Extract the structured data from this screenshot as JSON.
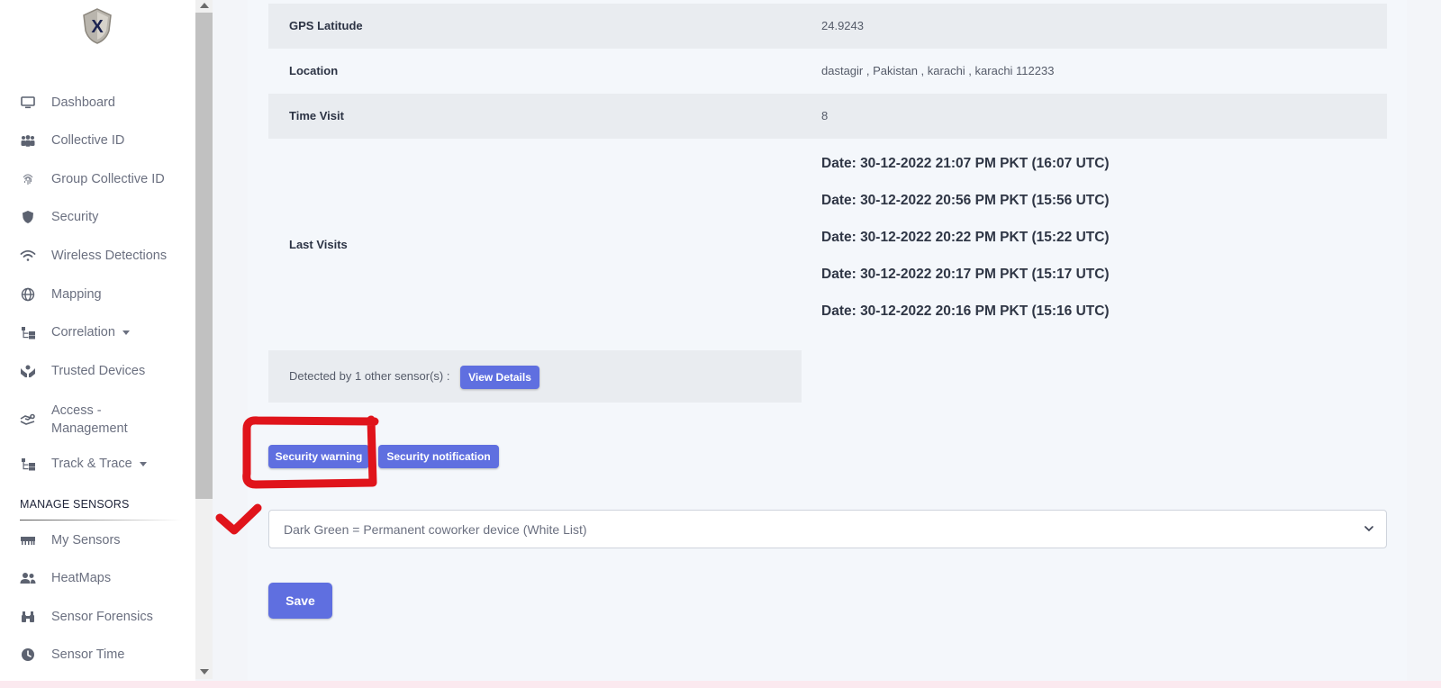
{
  "sidebar": {
    "items": [
      {
        "label": "Dashboard",
        "icon": "monitor-icon"
      },
      {
        "label": "Collective ID",
        "icon": "users-icon"
      },
      {
        "label": "Group Collective ID",
        "icon": "fingerprint-icon"
      },
      {
        "label": "Security",
        "icon": "shield-icon"
      },
      {
        "label": "Wireless Detections",
        "icon": "wifi-icon"
      },
      {
        "label": "Mapping",
        "icon": "globe-icon"
      },
      {
        "label": "Correlation",
        "icon": "sitemap-icon"
      },
      {
        "label": "Trusted Devices",
        "icon": "hands-icon"
      },
      {
        "label": "Access - Management",
        "icon": "hand-key-icon"
      },
      {
        "label": "Track & Trace",
        "icon": "sitemap-icon"
      }
    ],
    "section_title": "MANAGE SENSORS",
    "sensor_items": [
      {
        "label": "My Sensors",
        "icon": "sensor-icon"
      },
      {
        "label": "HeatMaps",
        "icon": "group-icon"
      },
      {
        "label": "Sensor Forensics",
        "icon": "binoculars-icon"
      },
      {
        "label": "Sensor Time",
        "icon": "clock-icon"
      }
    ]
  },
  "details": {
    "gps_latitude": {
      "label": "GPS Latitude",
      "value": "24.9243"
    },
    "location": {
      "label": "Location",
      "value": "dastagir , Pakistan , karachi , karachi 112233"
    },
    "time_visit": {
      "label": "Time Visit",
      "value": "8"
    },
    "last_visits": {
      "label": "Last Visits",
      "dates": [
        "Date: 30-12-2022 21:07 PM PKT (16:07 UTC)",
        "Date: 30-12-2022 20:56 PM PKT (15:56 UTC)",
        "Date: 30-12-2022 20:22 PM PKT (15:22 UTC)",
        "Date: 30-12-2022 20:17 PM PKT (15:17 UTC)",
        "Date: 30-12-2022 20:16 PM PKT (15:16 UTC)"
      ]
    }
  },
  "detected": {
    "text": "Detected by 1 other sensor(s) :",
    "view_details_label": "View Details"
  },
  "actions": {
    "security_warning_label": "Security warning",
    "security_notification_label": "Security notification"
  },
  "classification_select": {
    "selected": "Dark Green = Permanent coworker device (White List)"
  },
  "save_label": "Save",
  "colors": {
    "accent": "#5f6fe0",
    "annotation": "#e0141b",
    "sidebar_bg": "#ffffff",
    "content_bg": "#f4f7fb"
  }
}
